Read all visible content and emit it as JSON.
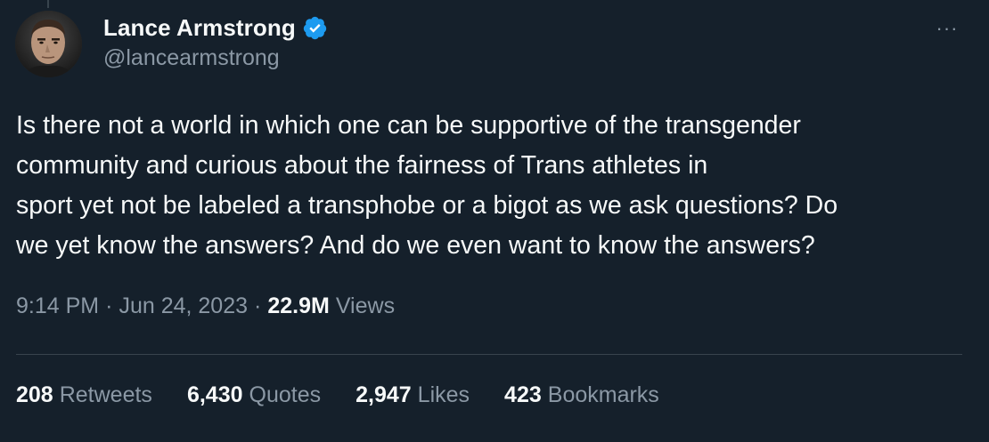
{
  "author": {
    "display_name": "Lance Armstrong",
    "handle": "@lancearmstrong",
    "verified": true,
    "avatar_icon": "profile-photo",
    "verified_icon": "verified-badge-icon",
    "verified_color": "#1d9bf0"
  },
  "menu": {
    "more_label": "···"
  },
  "tweet": {
    "text": "Is there not a world in which one can be supportive of the transgender\ncommunity and curious about the fairness of Trans athletes in\nsport yet not be labeled a transphobe or a bigot as we ask questions? Do\nwe yet know the answers? And do we even want to know the answers?"
  },
  "meta": {
    "time": "9:14 PM",
    "separator": "·",
    "date": "Jun 24, 2023",
    "views_count": "22.9M",
    "views_label": "Views"
  },
  "stats": [
    {
      "count": "208",
      "label": "Retweets"
    },
    {
      "count": "6,430",
      "label": "Quotes"
    },
    {
      "count": "2,947",
      "label": "Likes"
    },
    {
      "count": "423",
      "label": "Bookmarks"
    }
  ],
  "colors": {
    "background": "#15202b",
    "text_primary": "#f7f9f9",
    "text_secondary": "#8b98a5",
    "divider": "#38444d"
  }
}
